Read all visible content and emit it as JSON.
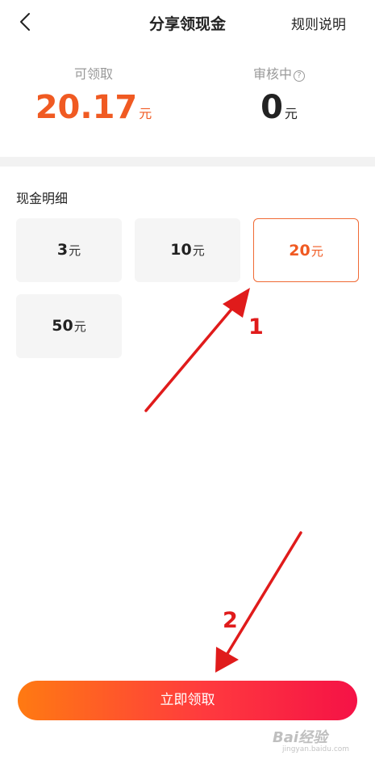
{
  "header": {
    "title": "分享领现金",
    "rules_label": "规则说明"
  },
  "stats": {
    "available": {
      "label": "可领取",
      "amount": "20.17",
      "unit": "元"
    },
    "reviewing": {
      "label": "审核中",
      "amount": "0",
      "unit": "元"
    }
  },
  "section": {
    "title": "现金明细"
  },
  "options": [
    {
      "amount": "3",
      "unit": "元",
      "selected": false
    },
    {
      "amount": "10",
      "unit": "元",
      "selected": false
    },
    {
      "amount": "20",
      "unit": "元",
      "selected": true
    },
    {
      "amount": "50",
      "unit": "元",
      "selected": false
    }
  ],
  "claim_button": {
    "label": "立即领取"
  },
  "annotations": {
    "step1": "1",
    "step2": "2"
  },
  "watermark": {
    "line1": "Bai经验",
    "line2": "jingyan.baidu.com"
  },
  "colors": {
    "accent": "#f05a22",
    "arrow": "#e01b1b",
    "button_start": "#ff7a12",
    "button_end": "#f51246"
  },
  "icons": {
    "back": "chevron-left-icon",
    "help": "question-circle-icon",
    "watermark": "paw-icon"
  }
}
